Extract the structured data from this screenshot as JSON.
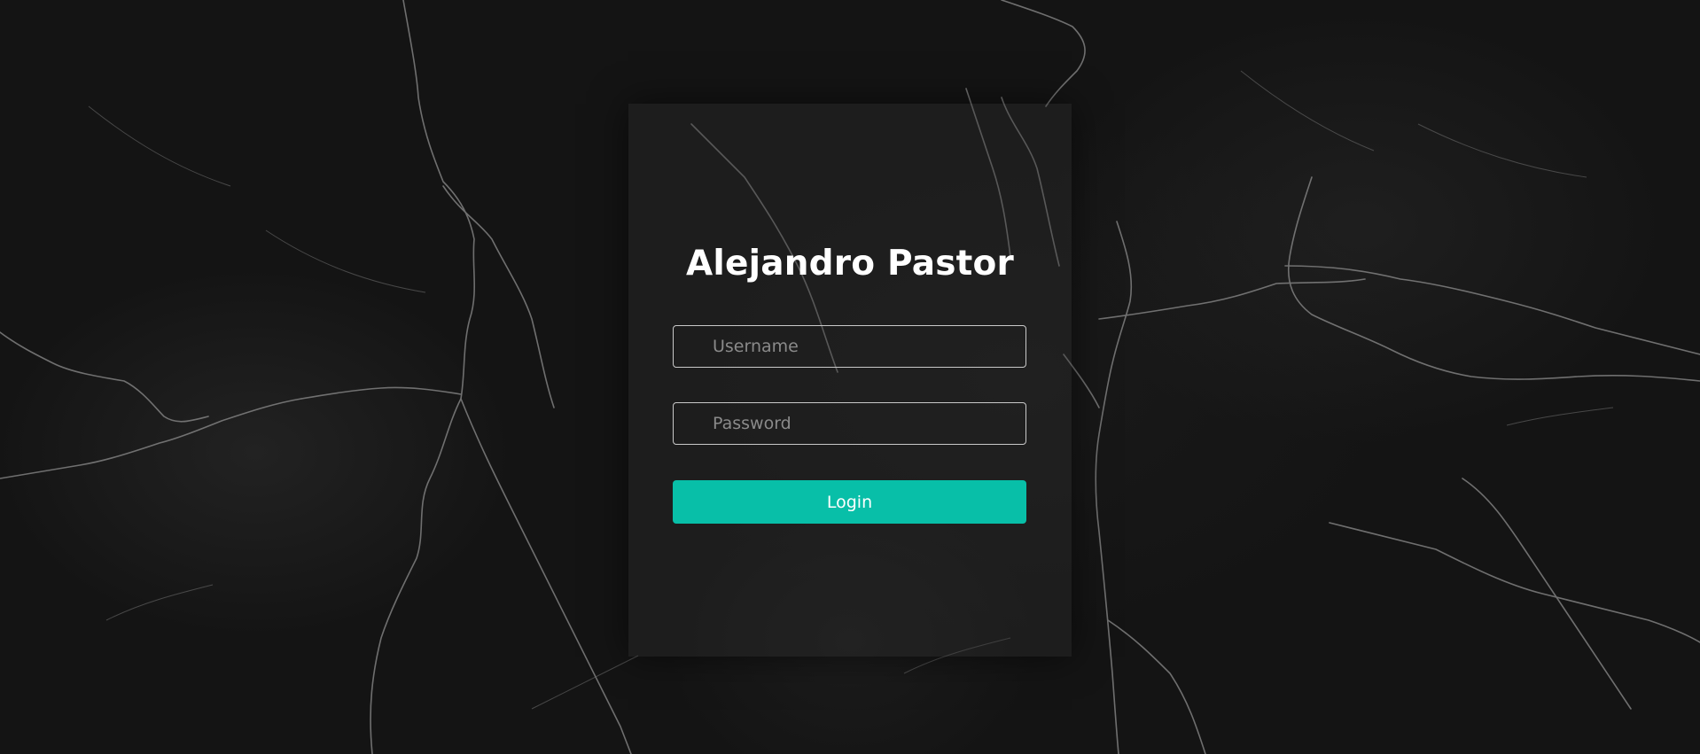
{
  "login": {
    "title": "Alejandro Pastor",
    "username_placeholder": "Username",
    "password_placeholder": "Password",
    "username_value": "",
    "password_value": "",
    "submit_label": "Login"
  },
  "colors": {
    "background": "#141414",
    "accent": "#08bfa8",
    "text": "#ffffff",
    "field_border": "#c9c9c9"
  }
}
